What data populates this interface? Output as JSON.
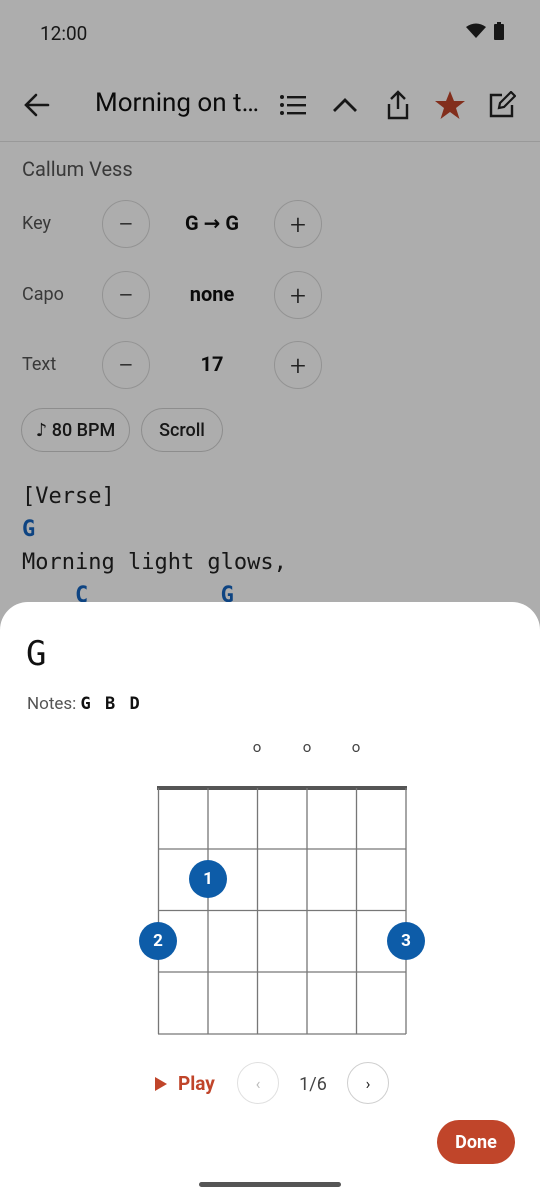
{
  "status": {
    "time": "12:00"
  },
  "appbar": {
    "title": "Morning on the Hill"
  },
  "artist": "Callum Vess",
  "controls": [
    {
      "label": "Key",
      "minus": "−",
      "value": "G → G",
      "plus": "+"
    },
    {
      "label": "Capo",
      "minus": "−",
      "value": "none",
      "plus": "+"
    },
    {
      "label": "Text",
      "minus": "−",
      "value": "17",
      "plus": "+"
    }
  ],
  "chips": {
    "bpm": "♪ 80 BPM",
    "scroll": "Scroll"
  },
  "song": {
    "section": "[Verse]",
    "chords1": "G",
    "lyric1": "Morning light glows,",
    "chords2": "    C          G"
  },
  "sheet": {
    "chord": "G",
    "notes_label": "Notes:",
    "notes": "G B D",
    "open_marker": "o",
    "fingers": [
      "1",
      "2",
      "3"
    ],
    "play": "Play",
    "prev": "‹",
    "next": "›",
    "page": "1/6",
    "done": "Done"
  },
  "colors": {
    "accent": "#c0452a",
    "chord_blue": "#1565c0",
    "finger_blue": "#0d5ca8"
  }
}
